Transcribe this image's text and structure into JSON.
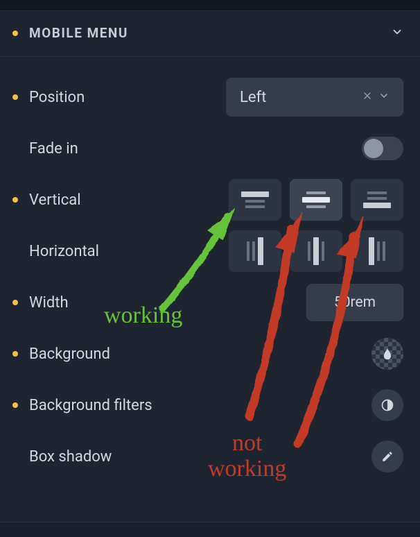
{
  "panel": {
    "title": "Mobile Menu"
  },
  "rows": {
    "position": {
      "label": "Position",
      "value": "Left"
    },
    "fade_in": {
      "label": "Fade in"
    },
    "vertical": {
      "label": "Vertical"
    },
    "horizontal": {
      "label": "Horizontal"
    },
    "width": {
      "label": "Width",
      "value": "50rem"
    },
    "background": {
      "label": "Background"
    },
    "background_filters": {
      "label": "Background filters"
    },
    "box_shadow": {
      "label": "Box shadow"
    }
  },
  "annotations": {
    "working": "working",
    "not_working_l1": "not",
    "not_working_l2": "working"
  }
}
